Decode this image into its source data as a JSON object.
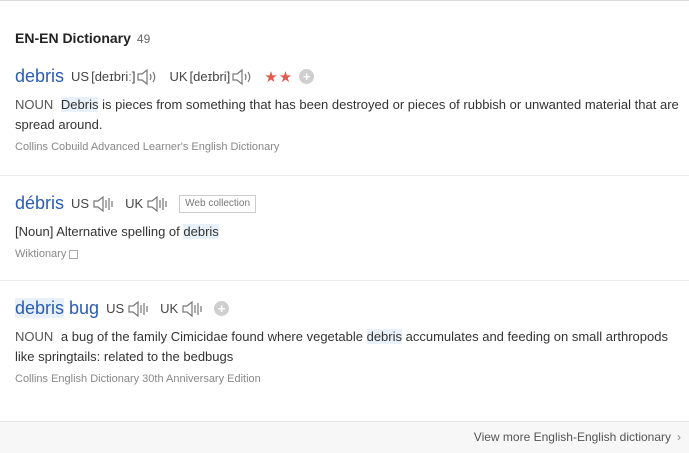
{
  "header": {
    "title": "EN-EN Dictionary",
    "count": "49"
  },
  "entries": [
    {
      "word": "debris",
      "us_label": "US",
      "us_pron": "[deɪbriː]",
      "uk_label": "UK",
      "uk_pron": "[deɪbri]",
      "stars": "★★",
      "pos": "NOUN",
      "def_highlight": "Debris",
      "def_rest": " is pieces from something that has been destroyed or pieces of rubbish or unwanted material that are spread around.",
      "source": "Collins Cobuild Advanced Learner's English Dictionary"
    },
    {
      "word": "débris",
      "us_label": "US",
      "uk_label": "UK",
      "tag": "Web collection",
      "def_prefix": "[Noun] Alternative spelling of ",
      "def_highlight": "debris",
      "source": "Wiktionary"
    },
    {
      "word_highlight": "debris",
      "word_rest": " bug",
      "us_label": "US",
      "uk_label": "UK",
      "pos": "NOUN",
      "def_prefix": "a bug of the family Cimicidae found where vegetable ",
      "def_highlight": "debris",
      "def_rest": " accumulates and feeding on small arthropods like springtails: related to the bedbugs",
      "source": "Collins English Dictionary 30th Anniversary Edition"
    }
  ],
  "footer": {
    "more_label": "View more English-English dictionary"
  },
  "icons": {
    "speaker": "speaker-icon",
    "add": "add-icon",
    "external": "external-link-icon",
    "chevron": "chevron-right-icon"
  },
  "colors": {
    "headword": "#2a5db0",
    "stars": "#e05a4d",
    "highlight": "#e8f0fa"
  }
}
